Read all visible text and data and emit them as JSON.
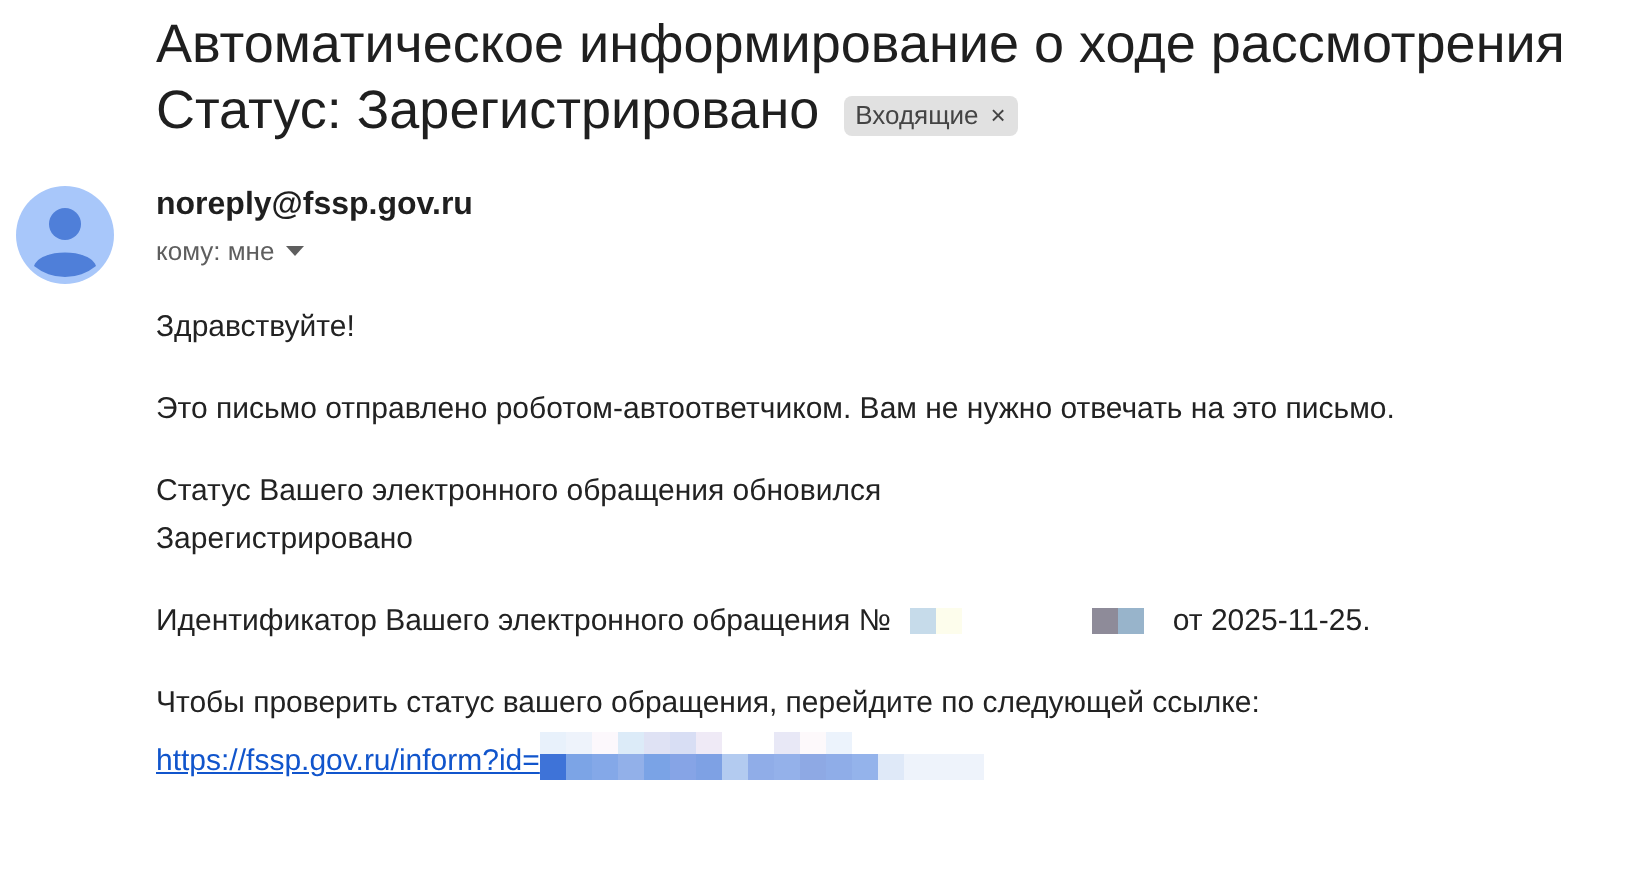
{
  "subject": {
    "line_1": "Автоматическое информирование о ходе рассмотрения",
    "line_2": "Статус: Зарегистрировано"
  },
  "label": {
    "text": "Входящие",
    "remove": "×"
  },
  "sender": {
    "email": "noreply@fssp.gov.ru",
    "recipient": "кому: мне"
  },
  "body": [
    {
      "kind": "text",
      "lines": [
        "Здравствуйте!"
      ]
    },
    {
      "kind": "text",
      "lines": [
        "Это письмо отправлено роботом-автоответчиком. Вам не нужно отвечать на это письмо."
      ]
    },
    {
      "kind": "text",
      "lines": [
        "Статус Вашего электронного обращения обновился",
        "Зарегистрировано"
      ]
    },
    {
      "kind": "redacted_id",
      "before": "Идентификатор Вашего электронного обращения №",
      "after": "от 2025-11-25."
    },
    {
      "kind": "link",
      "intro": "Чтобы проверить статус вашего обращения, перейдите по следующей ссылке:",
      "link": "https://fssp.gov.ru/inform?id="
    }
  ]
}
